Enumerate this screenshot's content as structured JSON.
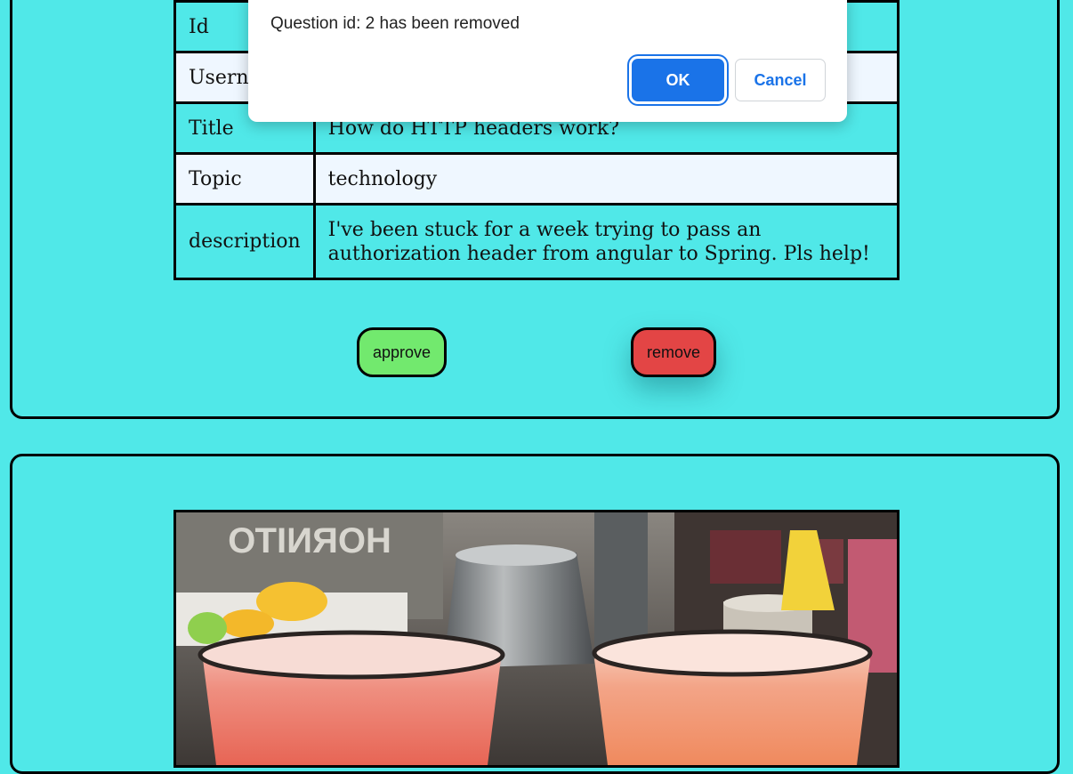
{
  "question": {
    "rows": [
      {
        "key": "Id",
        "value": ""
      },
      {
        "key": "Username",
        "value": ""
      },
      {
        "key": "Title",
        "value": "How do HTTP headers work?"
      },
      {
        "key": "Topic",
        "value": "technology"
      },
      {
        "key": "description",
        "value": "I've been stuck for a week trying to pass an authorization header from angular to Spring. Pls help!"
      }
    ],
    "approve_label": "approve",
    "remove_label": "remove"
  },
  "photo_card": {
    "image_name": "photo of two cocktails on a bar counter"
  },
  "dialog": {
    "message": "Question id: 2 has been removed",
    "ok_label": "OK",
    "cancel_label": "Cancel"
  },
  "colors": {
    "page_bg": "#50e8e8",
    "row_alt": "#eff7ff",
    "approve": "#72e96e",
    "remove": "#e34545",
    "dialog_primary": "#1a73e8"
  }
}
